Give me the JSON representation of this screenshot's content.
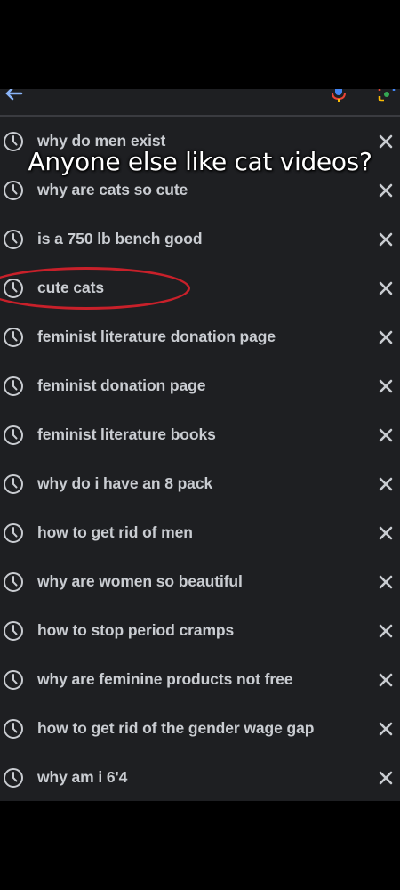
{
  "caption": "Anyone else like cat videos?",
  "history": [
    {
      "text": "why do men exist"
    },
    {
      "text": "why are cats so cute"
    },
    {
      "text": "is a 750 lb bench good"
    },
    {
      "text": "cute cats"
    },
    {
      "text": "feminist literature donation page"
    },
    {
      "text": "feminist donation page"
    },
    {
      "text": "feminist literature books"
    },
    {
      "text": "why do i have an 8 pack"
    },
    {
      "text": "how to get rid of men"
    },
    {
      "text": "why are women so beautiful"
    },
    {
      "text": "how to stop period cramps"
    },
    {
      "text": "why are feminine products not free"
    },
    {
      "text": "how to get rid of the gender wage gap"
    },
    {
      "text": "why am i 6'4"
    }
  ],
  "icons": {
    "row_icon": "clock-icon",
    "remove_icon": "close-icon",
    "back_icon": "back-arrow-icon",
    "mic_icon": "microphone-icon",
    "lens_icon": "google-lens-icon"
  },
  "colors": {
    "background": "#1e1f22",
    "text": "#c9ccd1",
    "annotation_circle": "#c8202a"
  }
}
